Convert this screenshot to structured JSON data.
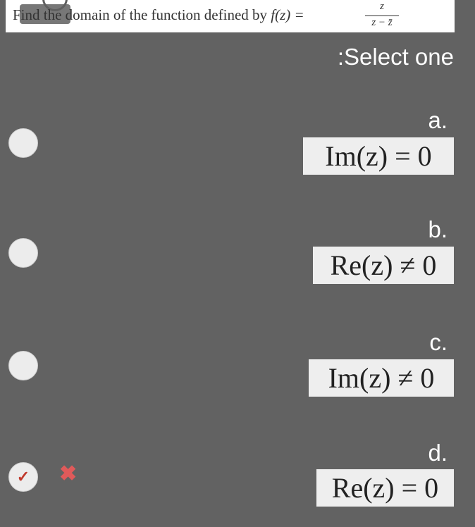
{
  "question": {
    "prefix": "Find the domain of the function defined by ",
    "func": "f(z) =",
    "numerator": "z",
    "denominator": "z − z̄"
  },
  "select_label": ":Select one",
  "options": [
    {
      "letter": "a.",
      "formula": "Im(z) = 0"
    },
    {
      "letter": "b.",
      "formula": "Re(z) ≠ 0"
    },
    {
      "letter": "c.",
      "formula": "Im(z) ≠ 0"
    },
    {
      "letter": "d.",
      "formula": "Re(z) = 0"
    }
  ],
  "selected_option": "d.",
  "icons": {
    "check": "✓",
    "wrong": "✖"
  },
  "colors": {
    "background": "#626262",
    "check": "#c0392b",
    "wrong": "#e05a5a"
  }
}
